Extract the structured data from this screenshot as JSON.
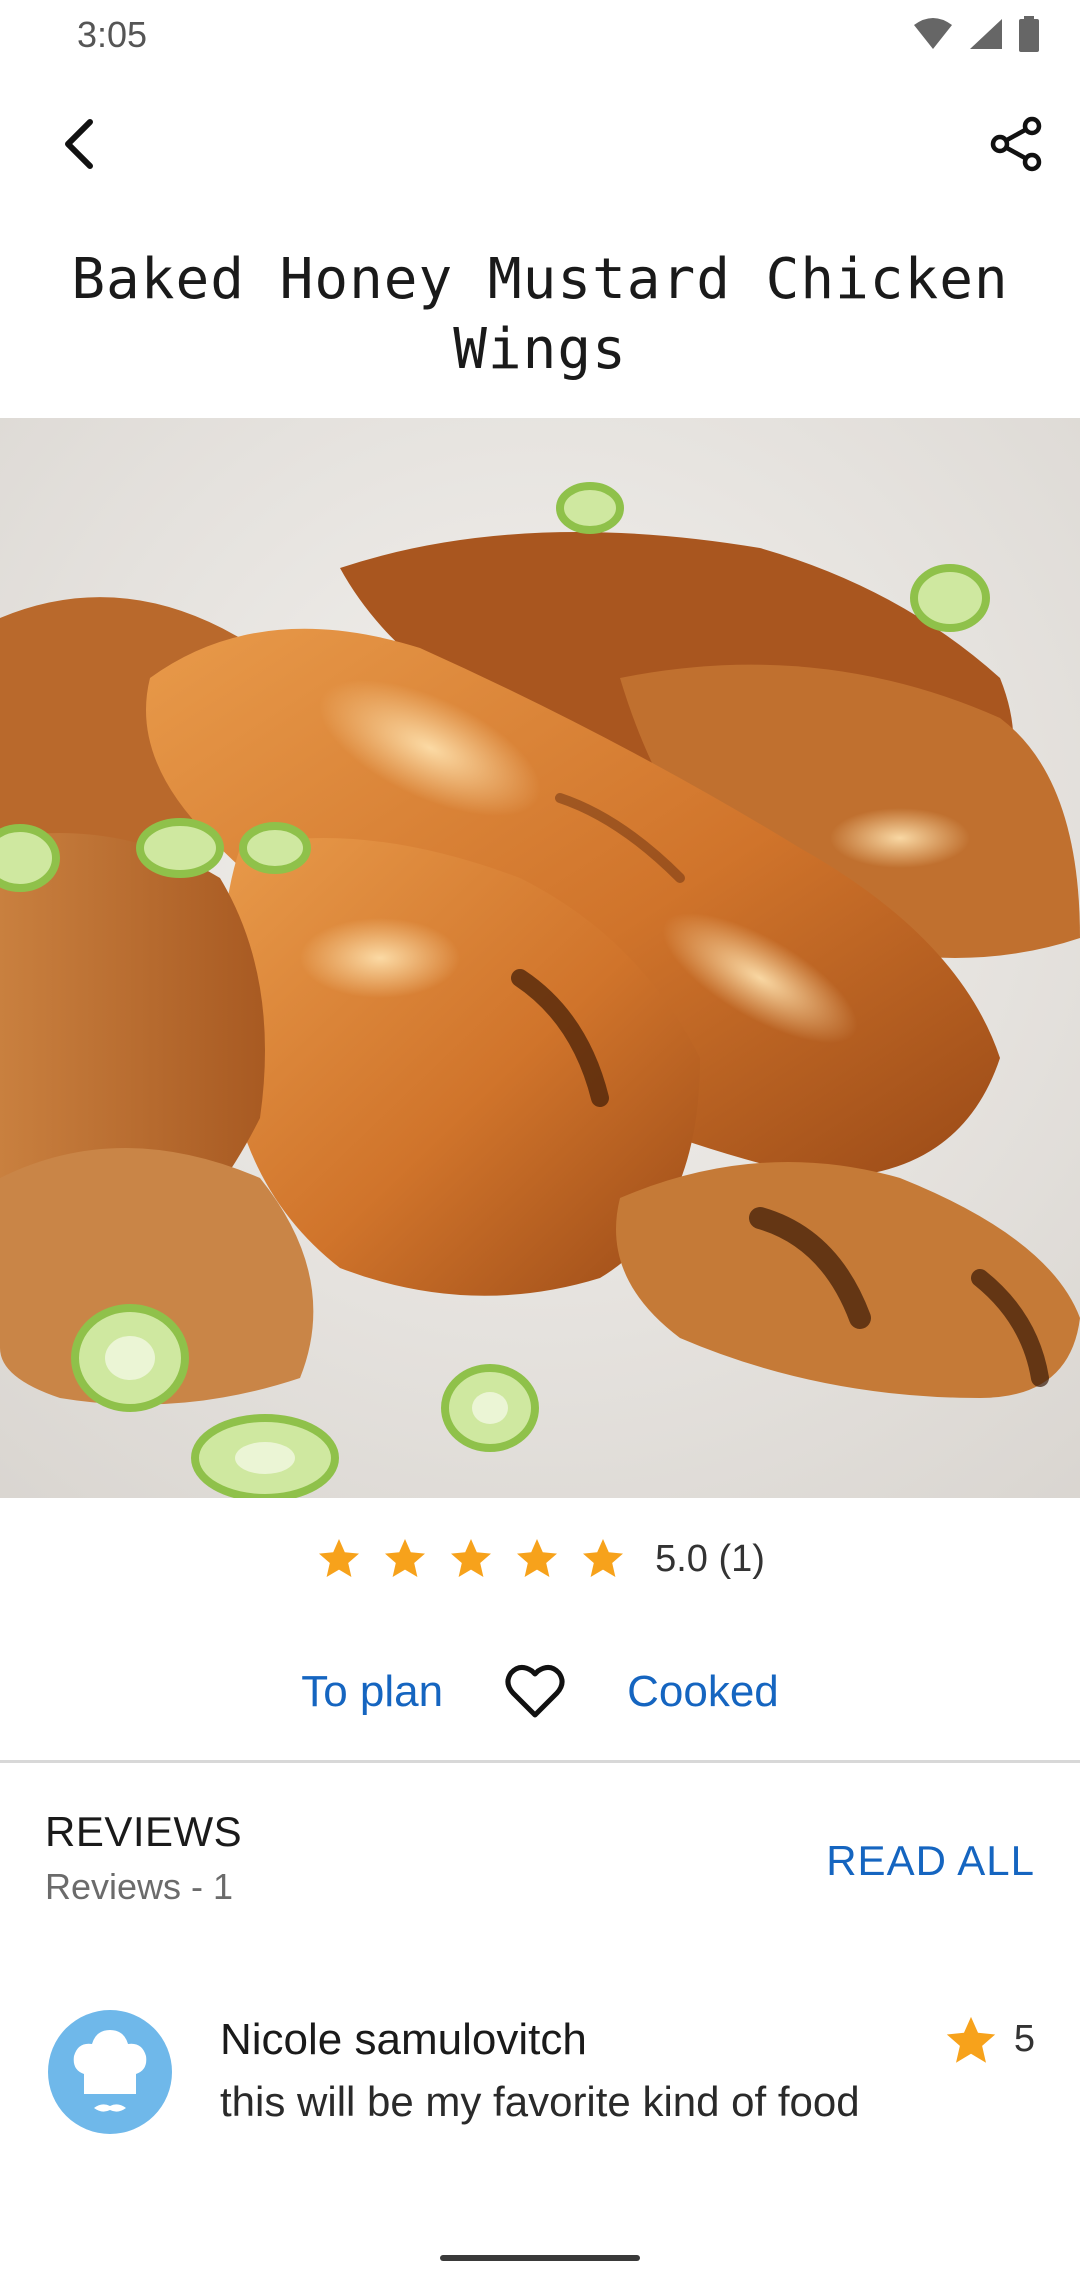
{
  "status_bar": {
    "time": "3:05"
  },
  "recipe": {
    "title": "Baked Honey Mustard Chicken Wings"
  },
  "rating": {
    "text": "5.0 (1)",
    "stars_filled": 5,
    "stars_total": 5,
    "star_color": "#f7a21b"
  },
  "actions": {
    "to_plan": "To plan",
    "cooked": "Cooked"
  },
  "reviews": {
    "heading": "REVIEWS",
    "count_text": "Reviews - 1",
    "read_all": "READ ALL",
    "items": [
      {
        "name": "Nicole samulovitch",
        "text": "this will be my favorite kind of food",
        "score": "5"
      }
    ]
  },
  "colors": {
    "accent": "#1565c0",
    "star": "#f7a21b",
    "avatar_bg": "#6fb8ea"
  },
  "icons": [
    "back-arrow-icon",
    "share-icon",
    "heart-outline-icon",
    "star-icon",
    "chef-hat-icon",
    "wifi-icon",
    "signal-icon",
    "battery-icon"
  ]
}
